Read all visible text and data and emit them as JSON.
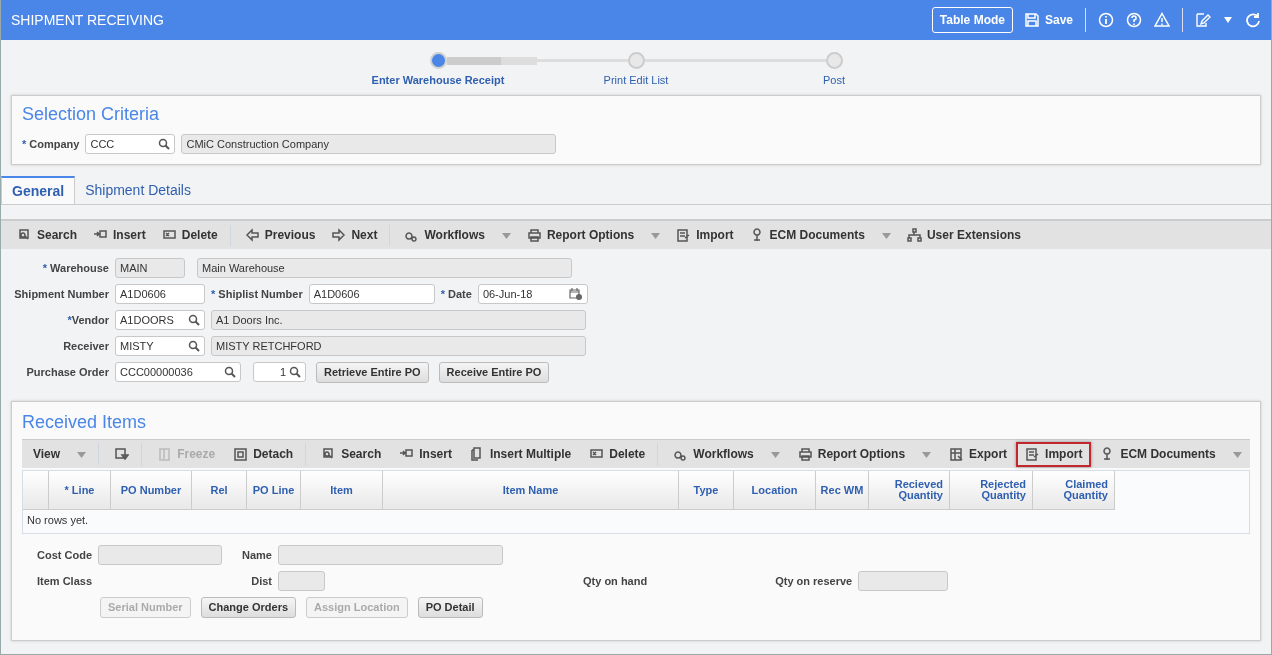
{
  "header": {
    "title": "SHIPMENT RECEIVING",
    "table_mode": "Table Mode",
    "save": "Save"
  },
  "steps": [
    {
      "label": "Enter Warehouse Receipt",
      "selected": true
    },
    {
      "label": "Print Edit List",
      "selected": false
    },
    {
      "label": "Post",
      "selected": false
    }
  ],
  "selection_criteria": {
    "title": "Selection Criteria",
    "company": {
      "mark": "*",
      "label": "Company",
      "value": "CCC",
      "description": "CMiC Construction Company"
    }
  },
  "tabs": [
    {
      "label": "General",
      "selected": true
    },
    {
      "label": "Shipment Details",
      "selected": false
    }
  ],
  "toolbar": [
    {
      "kind": "search",
      "label": "Search",
      "menu": false,
      "group_end": false
    },
    {
      "kind": "insert",
      "label": "Insert",
      "menu": false,
      "group_end": false
    },
    {
      "kind": "delete",
      "label": "Delete",
      "menu": false,
      "group_end": true
    },
    {
      "kind": "previous",
      "label": "Previous",
      "menu": false,
      "group_end": false
    },
    {
      "kind": "next",
      "label": "Next",
      "menu": false,
      "group_end": true
    },
    {
      "kind": "workflows",
      "label": "Workflows",
      "menu": true,
      "group_end": false
    },
    {
      "kind": "print",
      "label": "Report Options",
      "menu": true,
      "group_end": false
    },
    {
      "kind": "import",
      "label": "Import",
      "menu": false,
      "group_end": false
    },
    {
      "kind": "ecm",
      "label": "ECM Documents",
      "menu": true,
      "group_end": false
    },
    {
      "kind": "extensions",
      "label": "User Extensions",
      "menu": false,
      "group_end": false
    }
  ],
  "form": {
    "warehouse": {
      "mark": "*",
      "label": "Warehouse",
      "value": "MAIN",
      "description": "Main Warehouse"
    },
    "shipment_number": {
      "label": "Shipment Number",
      "value": "A1D0606"
    },
    "shiplist_number": {
      "mark": "*",
      "label": "Shiplist Number",
      "value": "A1D0606"
    },
    "date": {
      "mark": "*",
      "label": "Date",
      "value": "06-Jun-18"
    },
    "vendor": {
      "mark": "*",
      "label": "Vendor",
      "value": "A1DOORS",
      "description": "A1 Doors Inc."
    },
    "receiver": {
      "label": "Receiver",
      "value": "MISTY",
      "description": "MISTY RETCHFORD"
    },
    "purchase_order": {
      "label": "Purchase Order",
      "value": "CCC00000036",
      "release": "1"
    },
    "buttons": [
      "Retrieve Entire PO",
      "Receive Entire PO"
    ]
  },
  "received_items": {
    "title": "Received Items",
    "toolbar": [
      {
        "kind": "view",
        "label": "View",
        "menu": true,
        "disabled": false,
        "highlighted": false,
        "group_end": true
      },
      {
        "kind": "filter",
        "menu": false,
        "disabled": false,
        "highlighted": false,
        "group_end": true
      },
      {
        "kind": "freeze",
        "label": "Freeze",
        "menu": false,
        "disabled": true,
        "highlighted": false,
        "group_end": false
      },
      {
        "kind": "detach",
        "label": "Detach",
        "menu": false,
        "disabled": false,
        "highlighted": false,
        "group_end": true
      },
      {
        "kind": "search",
        "label": "Search",
        "menu": false,
        "disabled": false,
        "highlighted": false,
        "group_end": false
      },
      {
        "kind": "insert",
        "label": "Insert",
        "menu": false,
        "disabled": false,
        "highlighted": false,
        "group_end": false
      },
      {
        "kind": "insert_multiple",
        "label": "Insert Multiple",
        "menu": false,
        "disabled": false,
        "highlighted": false,
        "group_end": false
      },
      {
        "kind": "delete",
        "label": "Delete",
        "menu": false,
        "disabled": false,
        "highlighted": false,
        "group_end": true
      },
      {
        "kind": "workflows",
        "label": "Workflows",
        "menu": true,
        "disabled": false,
        "highlighted": false,
        "group_end": false
      },
      {
        "kind": "print",
        "label": "Report Options",
        "menu": true,
        "disabled": false,
        "highlighted": false,
        "group_end": false
      },
      {
        "kind": "export",
        "label": "Export",
        "menu": false,
        "disabled": false,
        "highlighted": false,
        "group_end": false
      },
      {
        "kind": "import",
        "label": "Import",
        "menu": false,
        "disabled": false,
        "highlighted": true,
        "group_end": false
      },
      {
        "kind": "ecm",
        "label": "ECM Documents",
        "menu": true,
        "disabled": false,
        "highlighted": false,
        "group_end": false
      }
    ],
    "columns": [
      "* Line",
      "PO Number",
      "Rel",
      "PO Line",
      "Item",
      "Item Name",
      "Type",
      "Location",
      "Rec WM",
      "Recieved Quantity",
      "Rejected Quantity",
      "Claimed Quantity"
    ],
    "empty_message": "No rows yet.",
    "cost_code": {
      "label": "Cost Code"
    },
    "name": {
      "label": "Name"
    },
    "item_class": {
      "label": "Item Class"
    },
    "dist": {
      "label": "Dist"
    },
    "qty_on_hand": {
      "label": "Qty on hand"
    },
    "qty_on_reserve": {
      "label": "Qty on reserve"
    },
    "buttons": [
      {
        "label": "Serial Number",
        "disabled": true
      },
      {
        "label": "Change Orders",
        "disabled": false
      },
      {
        "label": "Assign Location",
        "disabled": true
      },
      {
        "label": "PO Detail",
        "disabled": false
      }
    ]
  }
}
